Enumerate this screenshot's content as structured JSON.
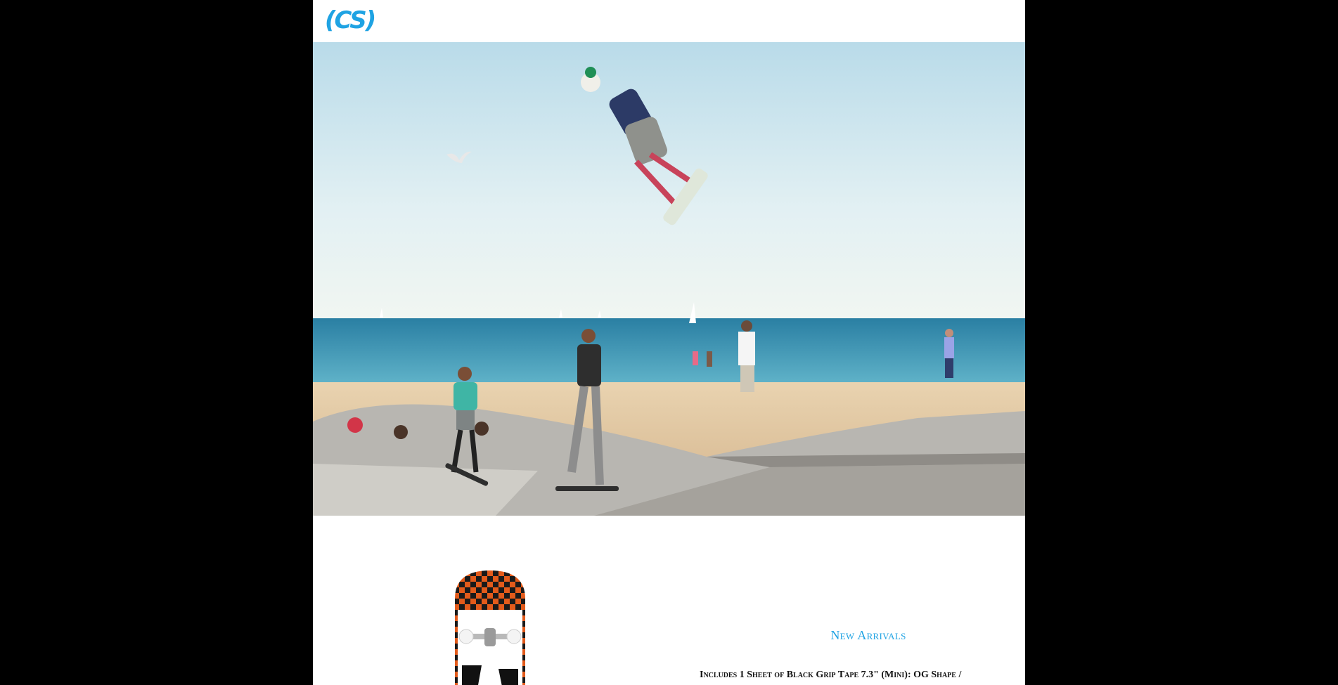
{
  "header": {
    "logo_text": "(CS)",
    "logo_color": "#1fa3e3"
  },
  "hero": {
    "image_subject": "skatepark-on-beach-photo"
  },
  "products": {
    "section_title": "New Arrivals",
    "item_description": "Includes 1 Sheet of Black Grip Tape 7.3\" (Mini): OG Shape /"
  },
  "colors": {
    "background": "#000000",
    "page": "#ffffff",
    "accent": "#1fa3e3"
  }
}
